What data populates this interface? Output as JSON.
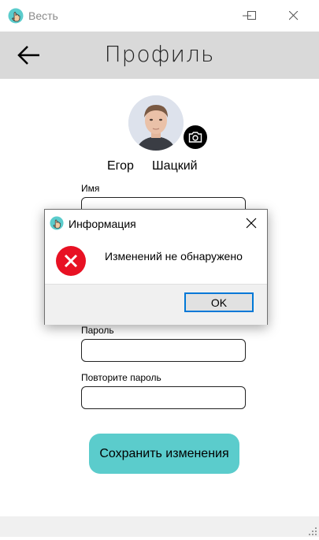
{
  "window": {
    "title": "Весть"
  },
  "header": {
    "title": "Профиль"
  },
  "profile": {
    "first_name": "Егор",
    "last_name": "Шацкий"
  },
  "form": {
    "name_label": "Имя",
    "password_label": "Пароль",
    "password_repeat_label": "Повторите пароль",
    "save_button": "Сохранить изменения"
  },
  "dialog": {
    "title": "Информация",
    "message": "Изменений не обнаружено",
    "ok_button": "OK"
  },
  "colors": {
    "accent": "#5bcccc",
    "header_bg": "#d9d9d9",
    "error": "#e81123",
    "ok_focus": "#0078d7"
  },
  "icons": [
    "hand-icon",
    "minimize-icon",
    "maximize-icon",
    "close-icon",
    "back-arrow-icon",
    "camera-icon",
    "error-icon"
  ]
}
